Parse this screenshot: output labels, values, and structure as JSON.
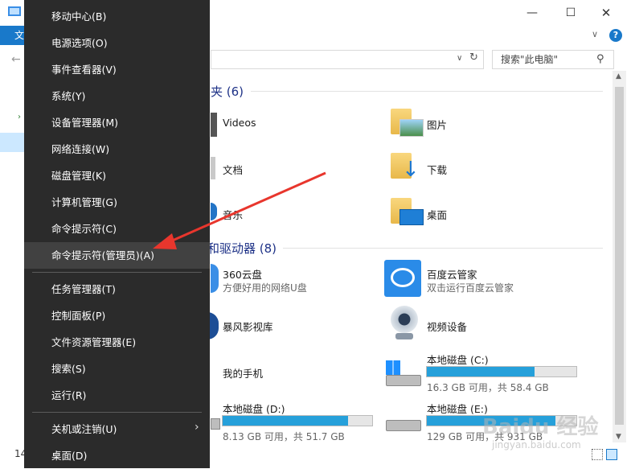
{
  "explorer": {
    "ribbon_tab": "文",
    "search_placeholder": "搜索\"此电脑\"",
    "folders_header": "夹 (6)",
    "devices_header": "和驱动器 (8)",
    "folders": [
      {
        "label": "Videos"
      },
      {
        "label": "图片"
      },
      {
        "label": "文档"
      },
      {
        "label": "下载"
      },
      {
        "label": "音乐"
      },
      {
        "label": "桌面"
      }
    ],
    "devices": [
      {
        "label": "360云盘",
        "sub": "方便好用的网络U盘"
      },
      {
        "label": "百度云管家",
        "sub": "双击运行百度云管家"
      },
      {
        "label": "暴风影视库",
        "sub": ""
      },
      {
        "label": "视频设备",
        "sub": ""
      },
      {
        "label": "我的手机",
        "sub": ""
      },
      {
        "label": "本地磁盘 (C:)",
        "sub": "16.3 GB 可用，共 58.4 GB",
        "used_fraction": 0.72
      },
      {
        "label": "本地磁盘 (D:)",
        "sub": "8.13 GB 可用，共 51.7 GB",
        "used_fraction": 0.84
      },
      {
        "label": "本地磁盘 (E:)",
        "sub": "129 GB 可用，共 931 GB",
        "used_fraction": 0.86
      }
    ],
    "status_left": "14",
    "watermark": "Baidu 经验",
    "watermark_url": "jingyan.baidu.com"
  },
  "menu": {
    "items": [
      {
        "label": "移动中心(B)"
      },
      {
        "label": "电源选项(O)"
      },
      {
        "label": "事件查看器(V)"
      },
      {
        "label": "系统(Y)"
      },
      {
        "label": "设备管理器(M)"
      },
      {
        "label": "网络连接(W)"
      },
      {
        "label": "磁盘管理(K)"
      },
      {
        "label": "计算机管理(G)"
      },
      {
        "label": "命令提示符(C)"
      },
      {
        "label": "命令提示符(管理员)(A)"
      },
      {
        "label": "任务管理器(T)"
      },
      {
        "label": "控制面板(P)"
      },
      {
        "label": "文件资源管理器(E)"
      },
      {
        "label": "搜索(S)"
      },
      {
        "label": "运行(R)"
      },
      {
        "label": "关机或注销(U)"
      },
      {
        "label": "桌面(D)"
      }
    ]
  },
  "colors": {
    "menu_bg": "#2b2b2b",
    "menu_highlight": "#414141",
    "accent": "#1979ca",
    "drive_bar": "#26a0da",
    "annotation_arrow": "#e8362d"
  }
}
